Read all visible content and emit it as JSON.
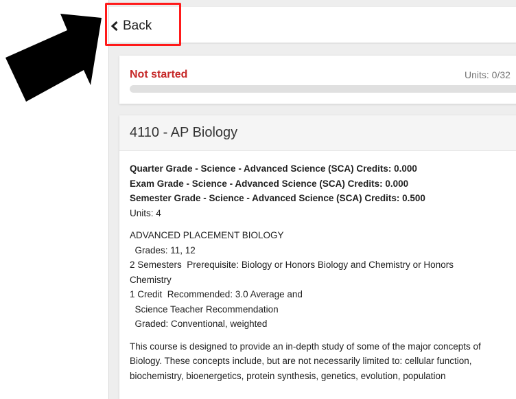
{
  "nav": {
    "back_label": "Back"
  },
  "progress": {
    "status": "Not started",
    "units": "Units: 0/32",
    "fraction": 0
  },
  "course": {
    "title": "4110 - AP Biology",
    "credits": [
      "Quarter Grade - Science - Advanced Science (SCA) Credits: 0.000",
      "Exam Grade - Science - Advanced Science (SCA) Credits: 0.000",
      "Semester Grade - Science - Advanced Science (SCA) Credits: 0.500"
    ],
    "units": "Units: 4",
    "details": [
      "ADVANCED PLACEMENT BIOLOGY",
      "  Grades: 11, 12",
      "2 Semesters  Prerequisite: Biology or Honors Biology and Chemistry or Honors",
      "Chemistry",
      "1 Credit  Recommended: 3.0 Average and",
      "  Science Teacher Recommendation",
      "  Graded: Conventional, weighted"
    ],
    "description": "This course is designed to provide an in-depth study of some of the major concepts of Biology. These concepts include, but are not necessarily limited to: cellular function, biochemistry, bioenergetics, protein synthesis, genetics, evolution, population"
  },
  "colors": {
    "status_red": "#c62828",
    "highlight_red": "#ff1a1a",
    "annotation_arrow": "#000000",
    "page_background": "#eeeeee"
  },
  "icons": {
    "back": "chevron-left-icon",
    "annotation": "arrow-annotation-icon"
  }
}
